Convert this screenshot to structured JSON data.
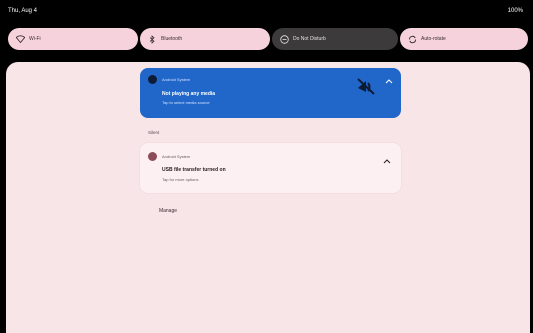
{
  "status": {
    "date": "Thu, Aug 4",
    "battery": "100%"
  },
  "tiles": [
    {
      "label": "Wi-Fi",
      "icon": "wifi-icon"
    },
    {
      "label": "Bluetooth",
      "icon": "bluetooth-icon"
    },
    {
      "label": "Do Not Disturb",
      "icon": "do-not-disturb-icon"
    },
    {
      "label": "Auto-rotate",
      "icon": "auto-rotate-icon"
    }
  ],
  "media": {
    "app": "Android System",
    "title": "Not playing any media",
    "subtitle": "Tap to select media source"
  },
  "section_label": "Silent",
  "notification": {
    "app": "Android System",
    "title": "USB file transfer turned on",
    "subtitle": "Tap for more options"
  },
  "manage_label": "Manage",
  "colors": {
    "accent": "#2167c9",
    "tile": "#f6d3dc",
    "panel": "#f8e5e8"
  }
}
